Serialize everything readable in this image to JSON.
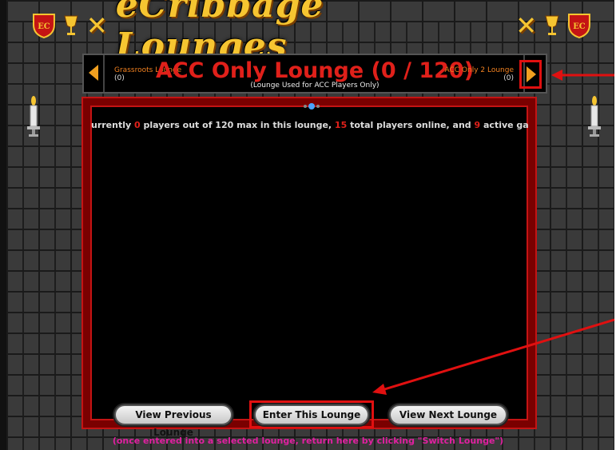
{
  "header": {
    "title": "eCribbage Lounges",
    "shield_text": "EC"
  },
  "lounge_nav": {
    "previous": {
      "name": "Grassroots Lounge",
      "count": "(0)"
    },
    "current": {
      "title": "ACC Only Lounge (0 / 120)",
      "subtitle": "(Lounge Used for ACC Players Only)"
    },
    "next": {
      "name": "ACC Only 2 Lounge",
      "count": "(0)"
    }
  },
  "status": {
    "prefix": "urrently ",
    "players": "0",
    "mid1": " players out of 120 max in this lounge, ",
    "total": "15",
    "mid2": " total players online, and ",
    "games": "9",
    "suffix": " active games."
  },
  "buttons": {
    "previous": "View Previous Lounge",
    "enter": "Enter This Lounge",
    "next": "View Next Lounge"
  },
  "footer": {
    "note": "(once entered into a selected lounge, return here by clicking \"Switch Lounge\")"
  },
  "colors": {
    "title_gold": "#f6c531",
    "accent_red": "#e0201a",
    "highlight_red": "#e01010",
    "footer_magenta": "#e020a0"
  }
}
